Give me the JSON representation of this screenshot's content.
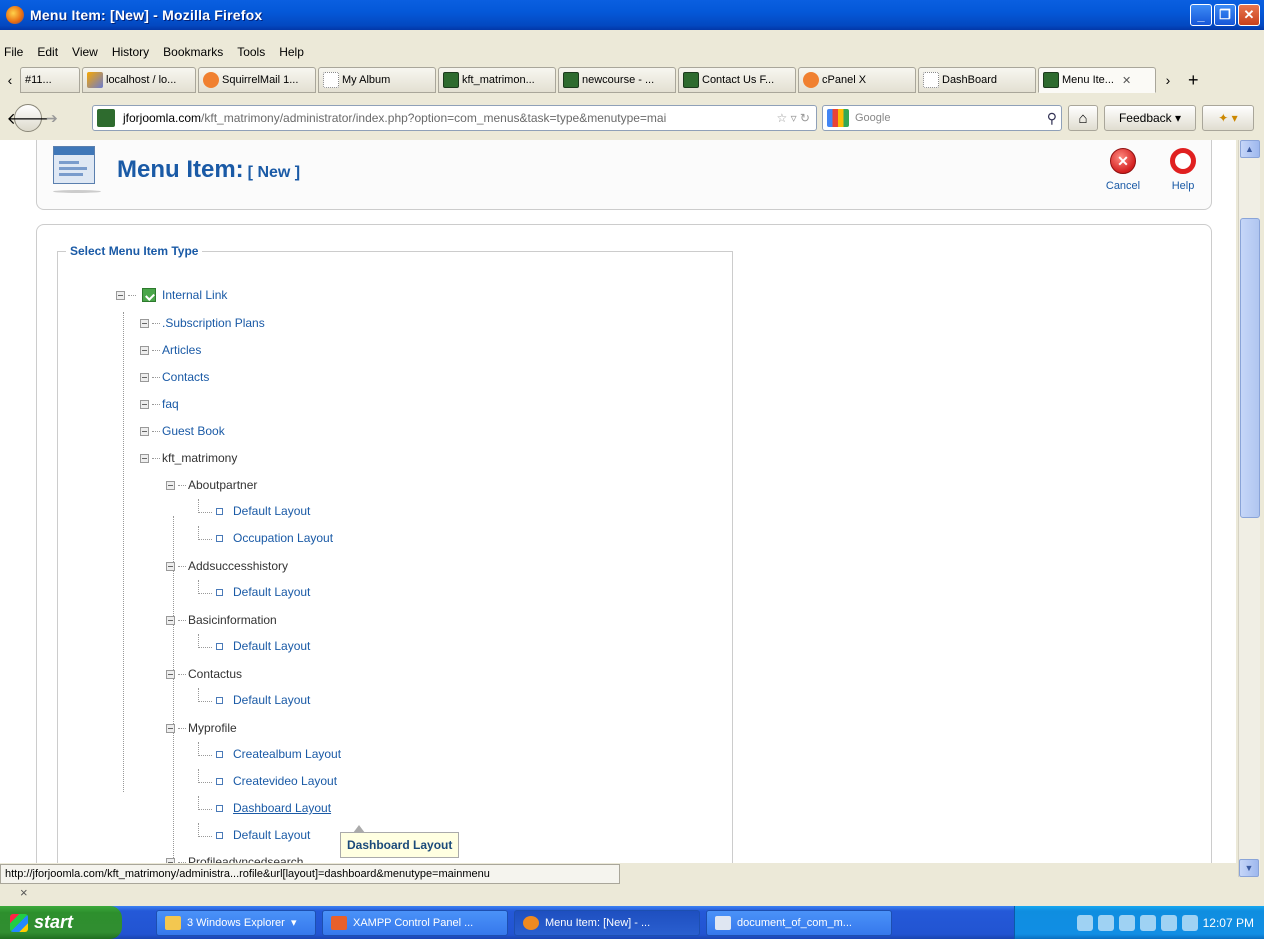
{
  "window": {
    "title": "Menu Item: [New] - Mozilla Firefox"
  },
  "menubar": [
    "File",
    "Edit",
    "View",
    "History",
    "Bookmarks",
    "Tools",
    "Help"
  ],
  "tabs": [
    {
      "label": "#11...",
      "icon": "blank"
    },
    {
      "label": "localhost / lo...",
      "icon": "pma"
    },
    {
      "label": "SquirrelMail 1...",
      "icon": "cpanel"
    },
    {
      "label": "My Album",
      "icon": "blank"
    },
    {
      "label": "kft_matrimon...",
      "icon": "joomla"
    },
    {
      "label": "newcourse - ...",
      "icon": "joomla"
    },
    {
      "label": "Contact Us F...",
      "icon": "joomla"
    },
    {
      "label": "cPanel X",
      "icon": "cpanel"
    },
    {
      "label": "DashBoard",
      "icon": "blank"
    },
    {
      "label": "Menu Ite...",
      "icon": "joomla",
      "active": true
    }
  ],
  "navbar": {
    "url_domain": "jforjoomla.com",
    "url_path": "/kft_matrimony/administrator/index.php?option=com_menus&task=type&menutype=mai",
    "search_placeholder": "Google",
    "feedback_label": "Feedback"
  },
  "page": {
    "title": "Menu Item:",
    "title_suffix": "[ New ]",
    "cancel_label": "Cancel",
    "help_label": "Help",
    "legend": "Select Menu Item Type",
    "tooltip": "Dashboard Layout"
  },
  "tree": {
    "root": "Internal Link",
    "top_items": [
      ".Subscription Plans",
      "Articles",
      "Contacts",
      "faq",
      "Guest Book",
      "kft_matrimony"
    ],
    "groups": [
      {
        "name": "Aboutpartner",
        "leaves": [
          "Default Layout",
          "Occupation Layout"
        ]
      },
      {
        "name": "Addsuccesshistory",
        "leaves": [
          "Default Layout"
        ]
      },
      {
        "name": "Basicinformation",
        "leaves": [
          "Default Layout"
        ]
      },
      {
        "name": "Contactus",
        "leaves": [
          "Default Layout"
        ]
      },
      {
        "name": "Myprofile",
        "leaves": [
          "Createalbum Layout",
          "Createvideo Layout",
          "Dashboard Layout",
          "Default Layout"
        ]
      },
      {
        "name": "Profileadvncedsearch",
        "leaves": []
      }
    ]
  },
  "status": {
    "url": "http://jforjoomla.com/kft_matrimony/administra...rofile&url[layout]=dashboard&menutype=mainmenu",
    "close": "×"
  },
  "taskbar": {
    "start": "start",
    "items": [
      {
        "label": "3 Windows Explorer"
      },
      {
        "label": "XAMPP Control Panel ..."
      },
      {
        "label": "Menu Item: [New] - ...",
        "active": true
      },
      {
        "label": "document_of_com_m..."
      }
    ],
    "clock": "12:07 PM"
  }
}
